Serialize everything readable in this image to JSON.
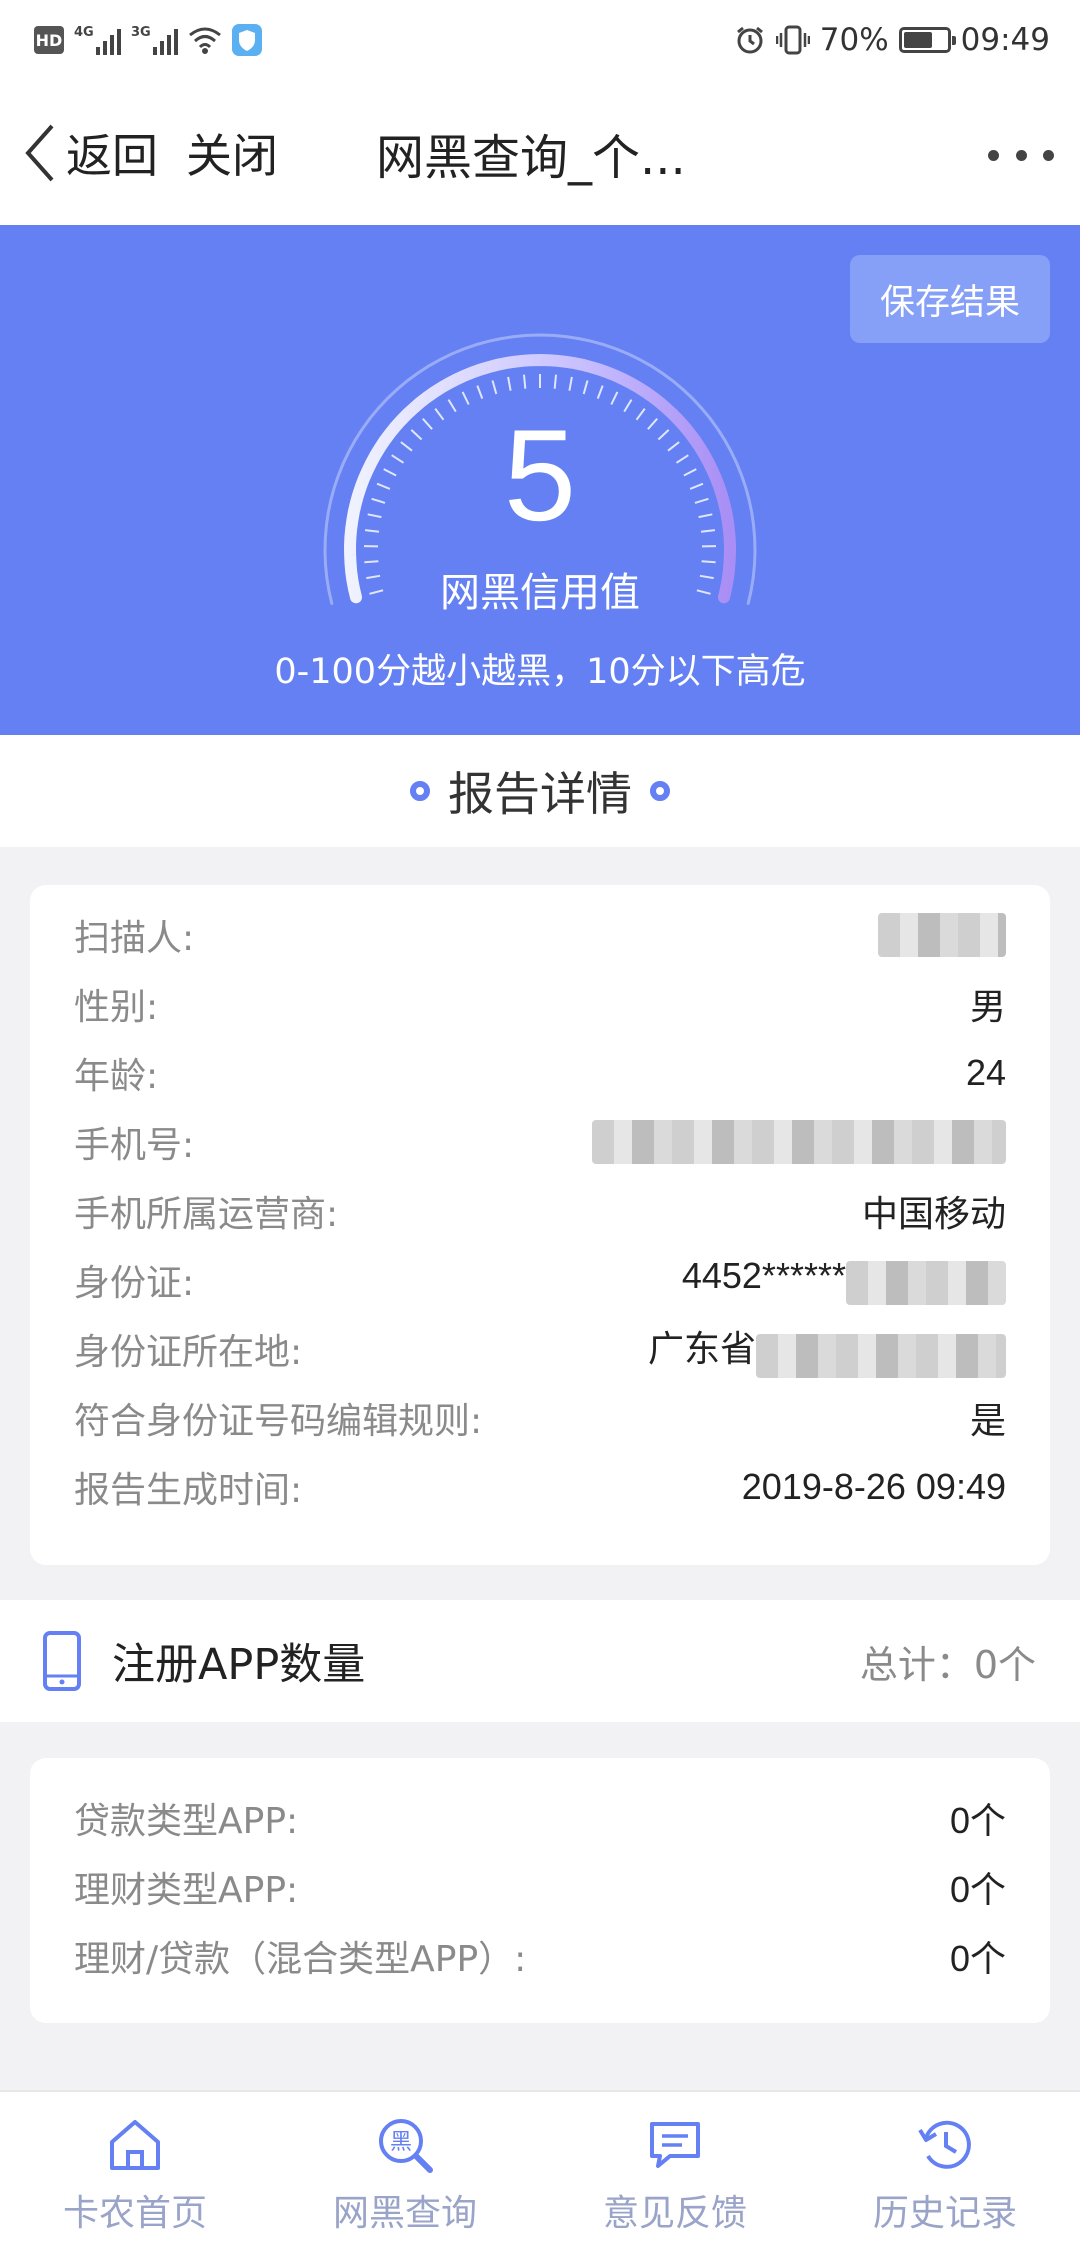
{
  "status_bar": {
    "left_badges": [
      "HD",
      "4G",
      "3G"
    ],
    "battery_percent": "70%",
    "battery_level": 0.7,
    "time": "09:49",
    "icons": [
      "hd-icon",
      "signal-icon",
      "wifi-icon",
      "shield-icon",
      "alarm-icon",
      "vibrate-icon",
      "battery-icon"
    ]
  },
  "nav": {
    "back_label": "返回",
    "close_label": "关闭",
    "title": "网黑查询_个..."
  },
  "hero": {
    "save_label": "保存结果",
    "score": "5",
    "score_label": "网黑信用值",
    "hint": "0-100分越小越黑，10分以下高危",
    "accent_color": "#6480f3"
  },
  "section": {
    "title": "报告详情"
  },
  "details": [
    {
      "label": "扫描人:",
      "value": ""
    },
    {
      "label": "性别:",
      "value": "男"
    },
    {
      "label": "年龄:",
      "value": "24"
    },
    {
      "label": "手机号:",
      "value": ""
    },
    {
      "label": "手机所属运营商:",
      "value": "中国移动"
    },
    {
      "label": "身份证:",
      "value": "4452******"
    },
    {
      "label": "身份证所在地:",
      "value": "广东省"
    },
    {
      "label": "符合身份证号码编辑规则:",
      "value": "是"
    },
    {
      "label": "报告生成时间:",
      "value": "2019-8-26 09:49"
    }
  ],
  "app_section": {
    "title": "注册APP数量",
    "total": "总计：0个",
    "rows": [
      {
        "label": "贷款类型APP:",
        "value": "0个"
      },
      {
        "label": "理财类型APP:",
        "value": "0个"
      },
      {
        "label": "理财/贷款（混合类型APP）:",
        "value": "0个"
      }
    ]
  },
  "tabs": [
    {
      "label": "卡农首页",
      "icon": "home-icon"
    },
    {
      "label": "网黑查询",
      "icon": "blacklist-search-icon",
      "icon_char": "黑"
    },
    {
      "label": "意见反馈",
      "icon": "feedback-icon"
    },
    {
      "label": "历史记录",
      "icon": "history-icon"
    }
  ]
}
